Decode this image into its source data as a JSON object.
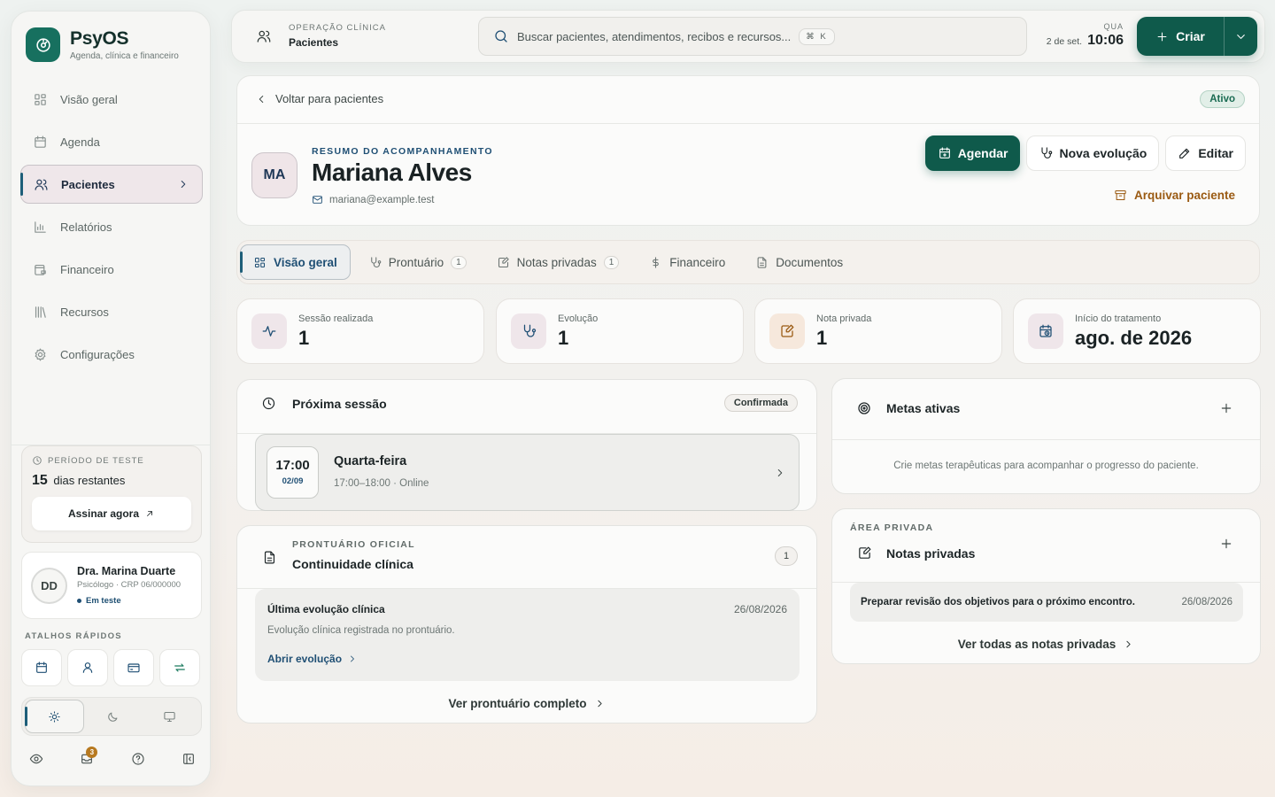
{
  "brand": {
    "name": "PsyOS",
    "tagline": "Agenda, clínica e financeiro"
  },
  "sidebar": {
    "items": [
      {
        "label": "Visão geral",
        "icon": "dashboard-icon"
      },
      {
        "label": "Agenda",
        "icon": "calendar-icon"
      },
      {
        "label": "Pacientes",
        "icon": "users-icon",
        "active": true
      },
      {
        "label": "Relatórios",
        "icon": "bar-chart-icon"
      },
      {
        "label": "Financeiro",
        "icon": "wallet-icon"
      },
      {
        "label": "Recursos",
        "icon": "library-icon"
      },
      {
        "label": "Configurações",
        "icon": "gear-icon"
      }
    ],
    "trial": {
      "label": "PERÍODO DE TESTE",
      "days": "15",
      "days_suffix": "dias restantes",
      "cta": "Assinar agora"
    },
    "profile": {
      "initials": "DD",
      "name": "Dra. Marina Duarte",
      "role": "Psicólogo · CRP 06/000000",
      "status": "Em teste"
    },
    "shortcuts_label": "ATALHOS RÁPIDOS",
    "notification_count": "3"
  },
  "topbar": {
    "context_label": "OPERAÇÃO CLÍNICA",
    "context_value": "Pacientes",
    "search_placeholder": "Buscar pacientes, atendimentos, recibos e recursos...",
    "search_shortcut": "⌘ K",
    "weekday": "QUA",
    "date": "2 de set.",
    "time": "10:06",
    "create_label": "Criar"
  },
  "patient": {
    "back_label": "Voltar para pacientes",
    "status": "Ativo",
    "initials": "MA",
    "eyebrow": "RESUMO DO ACOMPANHAMENTO",
    "name": "Mariana Alves",
    "email": "mariana@example.test",
    "actions": {
      "schedule": "Agendar",
      "new_evolution": "Nova evolução",
      "edit": "Editar",
      "archive": "Arquivar paciente"
    }
  },
  "tabs": [
    {
      "label": "Visão geral",
      "active": true
    },
    {
      "label": "Prontuário",
      "count": "1"
    },
    {
      "label": "Notas privadas",
      "count": "1"
    },
    {
      "label": "Financeiro"
    },
    {
      "label": "Documentos"
    }
  ],
  "stats": [
    {
      "label": "Sessão realizada",
      "value": "1"
    },
    {
      "label": "Evolução",
      "value": "1"
    },
    {
      "label": "Nota privada",
      "value": "1"
    },
    {
      "label": "Início do tratamento",
      "value": "ago. de 2026"
    }
  ],
  "next_session": {
    "title": "Próxima sessão",
    "status": "Confirmada",
    "time": "17:00",
    "date": "02/09",
    "day": "Quarta-feira",
    "detail": "17:00–18:00 · Online"
  },
  "record": {
    "eyebrow": "PRONTUÁRIO OFICIAL",
    "title": "Continuidade clínica",
    "count": "1",
    "last_title": "Última evolução clínica",
    "last_date": "26/08/2026",
    "last_desc": "Evolução clínica registrada no prontuário.",
    "open_link": "Abrir evolução",
    "more_link": "Ver prontuário completo"
  },
  "goals": {
    "title": "Metas ativas",
    "empty": "Crie metas terapêuticas para acompanhar o progresso do paciente."
  },
  "private_notes": {
    "eyebrow": "ÁREA PRIVADA",
    "title": "Notas privadas",
    "note_text": "Preparar revisão dos objetivos para o próximo encontro.",
    "note_date": "26/08/2026",
    "more_link": "Ver todas as notas privadas"
  },
  "colors": {
    "brand": "#17705f",
    "primary": "#0f5a4b",
    "accent": "#1f4f74",
    "warning": "#9a5a12"
  }
}
